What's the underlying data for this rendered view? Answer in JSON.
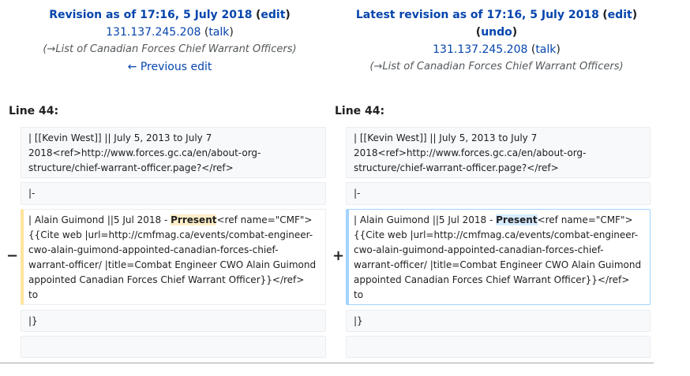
{
  "left_header": {
    "title_prefix": "Revision as of 17:16, 5 July 2018",
    "edit_label": "edit",
    "user": "131.137.245.208",
    "talk": "talk",
    "summary_arrow": "→",
    "summary_section": "List of Canadian Forces Chief Warrant Officers",
    "prev_edit": "← Previous edit"
  },
  "right_header": {
    "title_prefix": "Latest revision as of 17:16, 5 July 2018",
    "edit_label": "edit",
    "undo_label": "undo",
    "user": "131.137.245.208",
    "talk": "talk",
    "summary_arrow": "→",
    "summary_section": "List of Canadian Forces Chief Warrant Officers"
  },
  "line_label_left": "Line 44:",
  "line_label_right": "Line 44:",
  "diff": {
    "context1": "| [[Kevin West]] || July 5, 2013 to July 7\n2018<ref>http://www.forces.gc.ca/en/about-org-\nstructure/chief-warrant-officer.page?</ref>",
    "context2": "|-",
    "del_marker": "−",
    "add_marker": "+",
    "del_before": "| Alain Guimond ||5 Jul 2018 - ",
    "del_changed": "Prresent",
    "add_before": "| Alain Guimond ||5 Jul 2018 - ",
    "add_changed": "Present",
    "changed_after": "<ref name=\"CMF\">\n{{Cite web |url=http://cmfmag.ca/events/combat-engineer-\ncwo-alain-guimond-appointed-canadian-forces-chief-\nwarrant-officer/ |title=Combat Engineer CWO Alain Guimond\nappointed Canadian Forces Chief Warrant Officer}}</ref>\nto",
    "context3": "|}",
    "context4": ""
  }
}
